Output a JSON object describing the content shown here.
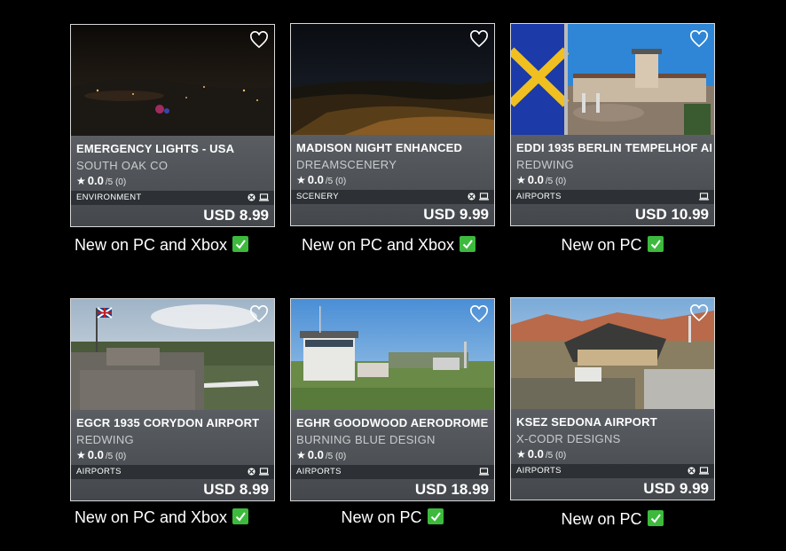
{
  "cards": [
    {
      "title": "EMERGENCY LIGHTS - USA",
      "publisher": "SOUTH OAK CO",
      "rating": "0.0",
      "rating_scale": "/5 (0)",
      "category": "ENVIRONMENT",
      "price": "USD 8.99",
      "platforms": [
        "xbox-icon",
        "pc-icon"
      ],
      "caption": "New on PC and Xbox"
    },
    {
      "title": "MADISON NIGHT ENHANCED",
      "publisher": "DREAMSCENERY",
      "rating": "0.0",
      "rating_scale": "/5 (0)",
      "category": "SCENERY",
      "price": "USD 9.99",
      "platforms": [
        "xbox-icon",
        "pc-icon"
      ],
      "caption": "New on PC and Xbox"
    },
    {
      "title": "EDDI 1935 BERLIN TEMPELHOF AI",
      "publisher": "REDWING",
      "rating": "0.0",
      "rating_scale": "/5 (0)",
      "category": "AIRPORTS",
      "price": "USD 10.99",
      "platforms": [
        "pc-icon"
      ],
      "caption": "New on PC"
    },
    {
      "title": "EGCR 1935 CORYDON AIRPORT",
      "publisher": "REDWING",
      "rating": "0.0",
      "rating_scale": "/5 (0)",
      "category": "AIRPORTS",
      "price": "USD 8.99",
      "platforms": [
        "xbox-icon",
        "pc-icon"
      ],
      "caption": "New on PC and Xbox"
    },
    {
      "title": "EGHR GOODWOOD AERODROME",
      "publisher": "BURNING BLUE DESIGN",
      "rating": "0.0",
      "rating_scale": "/5 (0)",
      "category": "AIRPORTS",
      "price": "USD 18.99",
      "platforms": [
        "pc-icon"
      ],
      "caption": "New on PC"
    },
    {
      "title": "KSEZ SEDONA AIRPORT",
      "publisher": "X-CODR DESIGNS",
      "rating": "0.0",
      "rating_scale": "/5 (0)",
      "category": "AIRPORTS",
      "price": "USD 9.99",
      "platforms": [
        "xbox-icon",
        "pc-icon"
      ],
      "caption": "New on PC"
    }
  ],
  "colors": {
    "background": "#000000",
    "card_info": "#4d5156",
    "check": "#3dba3d"
  },
  "icons": [
    "heart-icon",
    "star-icon",
    "xbox-icon",
    "pc-icon",
    "check-icon"
  ]
}
